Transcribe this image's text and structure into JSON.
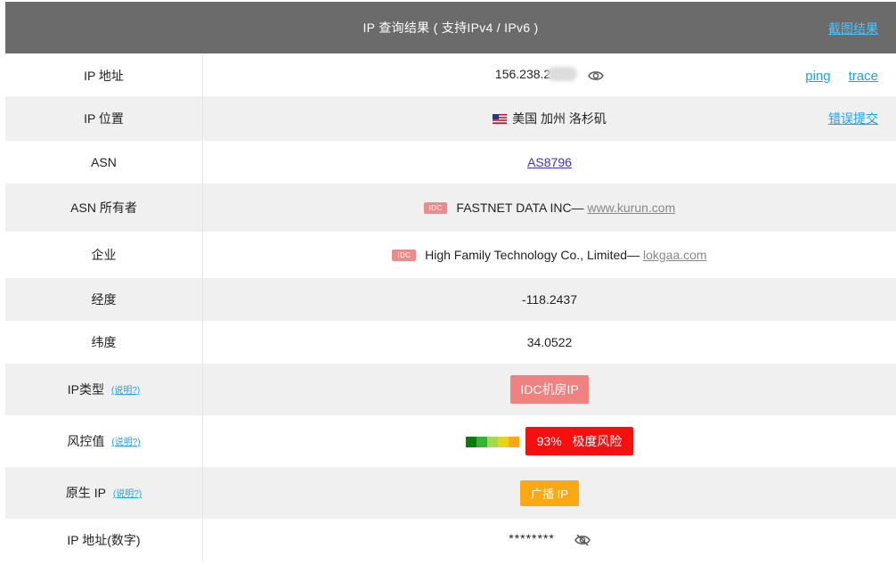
{
  "header": {
    "title": "IP 查询结果 ( 支持IPv4 / IPv6 )",
    "screenshot_link": "截图结果"
  },
  "rows": {
    "ip": {
      "label": "IP 地址",
      "value": "156.238.2",
      "ping": "ping",
      "trace": "trace"
    },
    "location": {
      "label": "IP 位置",
      "value": "美国 加州 洛杉矶",
      "report": "错误提交"
    },
    "asn": {
      "label": "ASN",
      "value": "AS8796"
    },
    "asn_owner": {
      "label": "ASN 所有者",
      "tag": "IDC",
      "name": "FASTNET DATA INC—",
      "site": "www.kurun.com"
    },
    "enterprise": {
      "label": "企业",
      "tag": "IDC",
      "name": "High Family Technology Co., Limited—",
      "site": "lokgaa.com"
    },
    "longitude": {
      "label": "经度",
      "value": "-118.2437"
    },
    "latitude": {
      "label": "纬度",
      "value": "34.0522"
    },
    "ip_type": {
      "label": "IP类型",
      "help": "(说明?)",
      "badge": "IDC机房IP"
    },
    "risk": {
      "label": "风控值",
      "help": "(说明?)",
      "percent": "93%",
      "level": "极度风险"
    },
    "native": {
      "label": "原生 IP",
      "help": "(说明?)",
      "badge": "广播 IP"
    },
    "numeric": {
      "label": "IP 地址(数字)",
      "value": "********"
    }
  },
  "colors": {
    "header_bg": "#6b6b6b",
    "link": "#1da1f2",
    "asn_link": "#3b2fd6",
    "idc_badge": "#ef8181",
    "risk_badge": "#f50f0f",
    "broadcast_badge": "#fba812",
    "risk_scale": [
      "#0a7a0a",
      "#33b233",
      "#a6d84a",
      "#e8d21a",
      "#fba812"
    ]
  },
  "icons": {
    "ip_reveal": "eye-icon",
    "numeric_hidden": "eye-slash-icon",
    "location_flag": "us-flag-icon"
  }
}
